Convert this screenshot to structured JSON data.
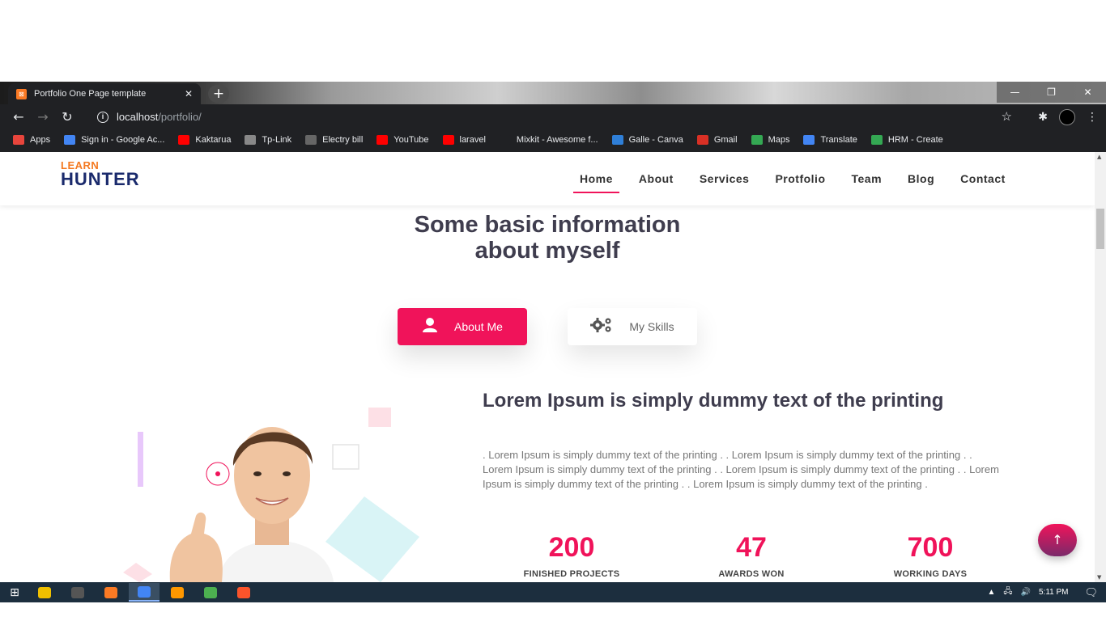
{
  "browser": {
    "tab_title": "Portfolio One Page template",
    "tab_close": "✕",
    "new_tab": "+",
    "window_controls": {
      "minimize": "—",
      "maximize": "❐",
      "close": "✕"
    },
    "url_host": "localhost",
    "url_path": "/portfolio/",
    "bookmarks": [
      {
        "label": "Apps",
        "icon": "apps-grid-icon",
        "color": "#e8453c"
      },
      {
        "label": "Sign in - Google Ac...",
        "icon": "google-icon",
        "color": "#4285f4"
      },
      {
        "label": "Kaktarua",
        "icon": "youtube-icon",
        "color": "#ff0000"
      },
      {
        "label": "Tp-Link",
        "icon": "globe-icon",
        "color": "#888888"
      },
      {
        "label": "Electry bill",
        "icon": "bill-icon",
        "color": "#666666"
      },
      {
        "label": "YouTube",
        "icon": "youtube-icon",
        "color": "#ff0000"
      },
      {
        "label": "laravel",
        "icon": "youtube-icon",
        "color": "#ff0000"
      },
      {
        "label": "Mixkit - Awesome f...",
        "icon": "mixkit-icon",
        "color": "#202124"
      },
      {
        "label": "Galle - Canva",
        "icon": "canva-icon",
        "color": "#2f7fd8"
      },
      {
        "label": "Gmail",
        "icon": "gmail-icon",
        "color": "#d93025"
      },
      {
        "label": "Maps",
        "icon": "maps-icon",
        "color": "#34a853"
      },
      {
        "label": "Translate",
        "icon": "translate-icon",
        "color": "#4285f4"
      },
      {
        "label": "HRM - Create",
        "icon": "hrm-icon",
        "color": "#34a853"
      }
    ]
  },
  "site": {
    "logo_top": "LEARN",
    "logo_bottom": "HUNTER",
    "nav": [
      "Home",
      "About",
      "Services",
      "Protfolio",
      "Team",
      "Blog",
      "Contact"
    ],
    "headline_line1": "Some basic information",
    "headline_line2": "about myself",
    "btn_about": "About Me",
    "btn_skills": "My Skills",
    "content_title": "Lorem Ipsum is simply dummy text of the printing",
    "content_body": ". Lorem Ipsum is simply dummy text of the printing . . Lorem Ipsum is simply dummy text of the printing . . Lorem Ipsum is simply dummy text of the printing . . Lorem Ipsum is simply dummy text of the printing . . Lorem Ipsum is simply dummy text of the printing . . Lorem Ipsum is simply dummy text of the printing .",
    "stats": [
      {
        "number": "200",
        "label": "FINISHED PROJECTS"
      },
      {
        "number": "47",
        "label": "AWARDS WON"
      },
      {
        "number": "700",
        "label": "WORKING DAYS"
      }
    ],
    "back_to_top": "↑",
    "accent_color": "#f0135a",
    "heading_color": "#3f3d4e"
  },
  "taskbar": {
    "clock": "5:11 PM",
    "apps": [
      "file-explorer-icon",
      "store-icon",
      "xampp-icon",
      "chrome-icon",
      "sublime-icon",
      "app-icon",
      "brave-icon"
    ]
  }
}
